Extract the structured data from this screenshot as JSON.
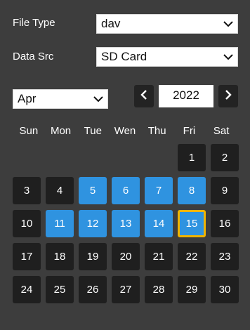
{
  "filters": {
    "file_type_label": "File Type",
    "file_type_value": "dav",
    "data_src_label": "Data Src",
    "data_src_value": "SD Card"
  },
  "calendar": {
    "month": "Apr",
    "year": "2022",
    "prev_icon": "chevron-left-icon",
    "next_icon": "chevron-right-icon",
    "weekdays": [
      "Sun",
      "Mon",
      "Tue",
      "Wen",
      "Thu",
      "Fri",
      "Sat"
    ],
    "leading_blanks": 5,
    "days": [
      {
        "d": "1",
        "record": false,
        "today": false
      },
      {
        "d": "2",
        "record": false,
        "today": false
      },
      {
        "d": "3",
        "record": false,
        "today": false
      },
      {
        "d": "4",
        "record": false,
        "today": false
      },
      {
        "d": "5",
        "record": true,
        "today": false
      },
      {
        "d": "6",
        "record": true,
        "today": false
      },
      {
        "d": "7",
        "record": true,
        "today": false
      },
      {
        "d": "8",
        "record": true,
        "today": false
      },
      {
        "d": "9",
        "record": false,
        "today": false
      },
      {
        "d": "10",
        "record": false,
        "today": false
      },
      {
        "d": "11",
        "record": true,
        "today": false
      },
      {
        "d": "12",
        "record": true,
        "today": false
      },
      {
        "d": "13",
        "record": true,
        "today": false
      },
      {
        "d": "14",
        "record": true,
        "today": false
      },
      {
        "d": "15",
        "record": true,
        "today": true
      },
      {
        "d": "16",
        "record": false,
        "today": false
      },
      {
        "d": "17",
        "record": false,
        "today": false
      },
      {
        "d": "18",
        "record": false,
        "today": false
      },
      {
        "d": "19",
        "record": false,
        "today": false
      },
      {
        "d": "20",
        "record": false,
        "today": false
      },
      {
        "d": "21",
        "record": false,
        "today": false
      },
      {
        "d": "22",
        "record": false,
        "today": false
      },
      {
        "d": "23",
        "record": false,
        "today": false
      },
      {
        "d": "24",
        "record": false,
        "today": false
      },
      {
        "d": "25",
        "record": false,
        "today": false
      },
      {
        "d": "26",
        "record": false,
        "today": false
      },
      {
        "d": "27",
        "record": false,
        "today": false
      },
      {
        "d": "28",
        "record": false,
        "today": false
      },
      {
        "d": "29",
        "record": false,
        "today": false
      },
      {
        "d": "30",
        "record": false,
        "today": false
      }
    ]
  },
  "colors": {
    "background": "#3d3d3d",
    "day_default": "#1f1f1f",
    "day_record": "#2f93e0",
    "today_border": "#f0b400"
  }
}
